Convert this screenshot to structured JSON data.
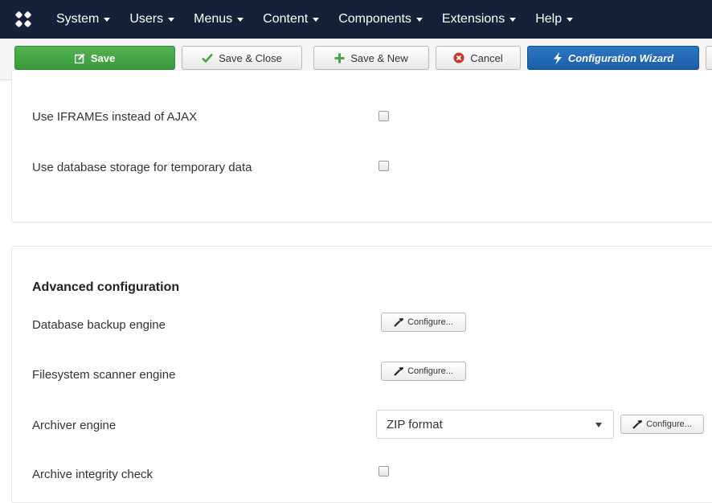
{
  "nav": {
    "items": [
      {
        "label": "System"
      },
      {
        "label": "Users"
      },
      {
        "label": "Menus"
      },
      {
        "label": "Content"
      },
      {
        "label": "Components"
      },
      {
        "label": "Extensions"
      },
      {
        "label": "Help"
      }
    ]
  },
  "toolbar": {
    "save_label": "Save",
    "save_close_label": "Save & Close",
    "save_new_label": "Save & New",
    "cancel_label": "Cancel",
    "wizard_label": "Configuration Wizard"
  },
  "general": {
    "iframes_label": "Use IFRAMEs instead of AJAX",
    "iframes_checked": false,
    "db_storage_label": "Use database storage for temporary data",
    "db_storage_checked": false
  },
  "advanced": {
    "heading": "Advanced configuration",
    "db_backup_label": "Database backup engine",
    "fs_scanner_label": "Filesystem scanner engine",
    "archiver_label": "Archiver engine",
    "archiver_value": "ZIP format",
    "integrity_label": "Archive integrity check",
    "integrity_checked": false,
    "configure_label": "Configure..."
  },
  "colors": {
    "navbar": "#152139",
    "success": "#46a546",
    "primary": "#1f65ad",
    "cancel_icon": "#c0392b"
  }
}
